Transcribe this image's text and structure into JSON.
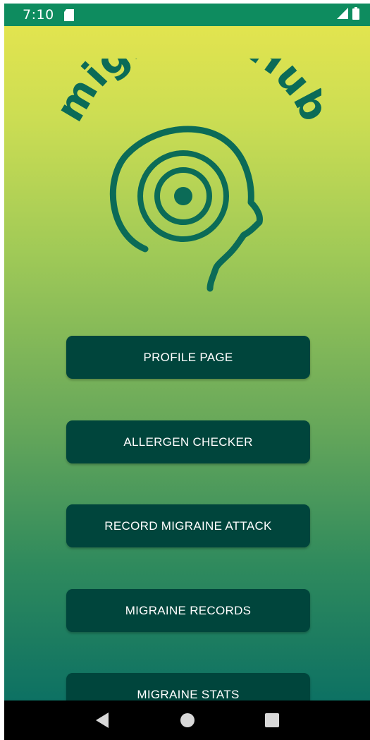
{
  "status_bar": {
    "time": "7:10",
    "icons": [
      "sd-card-icon",
      "signal-icon",
      "battery-icon"
    ],
    "background": "#0e8c5f"
  },
  "logo": {
    "text": "migraineHub",
    "color": "#0b6b57"
  },
  "menu": {
    "buttons": [
      {
        "label": "PROFILE PAGE"
      },
      {
        "label": "ALLERGEN CHECKER"
      },
      {
        "label": "RECORD MIGRAINE ATTACK"
      },
      {
        "label": "MIGRAINE RECORDS"
      },
      {
        "label": "MIGRAINE STATS"
      }
    ],
    "button_color": "#00453c"
  },
  "nav_bar": {
    "icons": [
      "back-icon",
      "home-icon",
      "recents-icon"
    ]
  },
  "colors": {
    "gradient_top": "#e2e44f",
    "gradient_bottom": "#0d7163"
  }
}
